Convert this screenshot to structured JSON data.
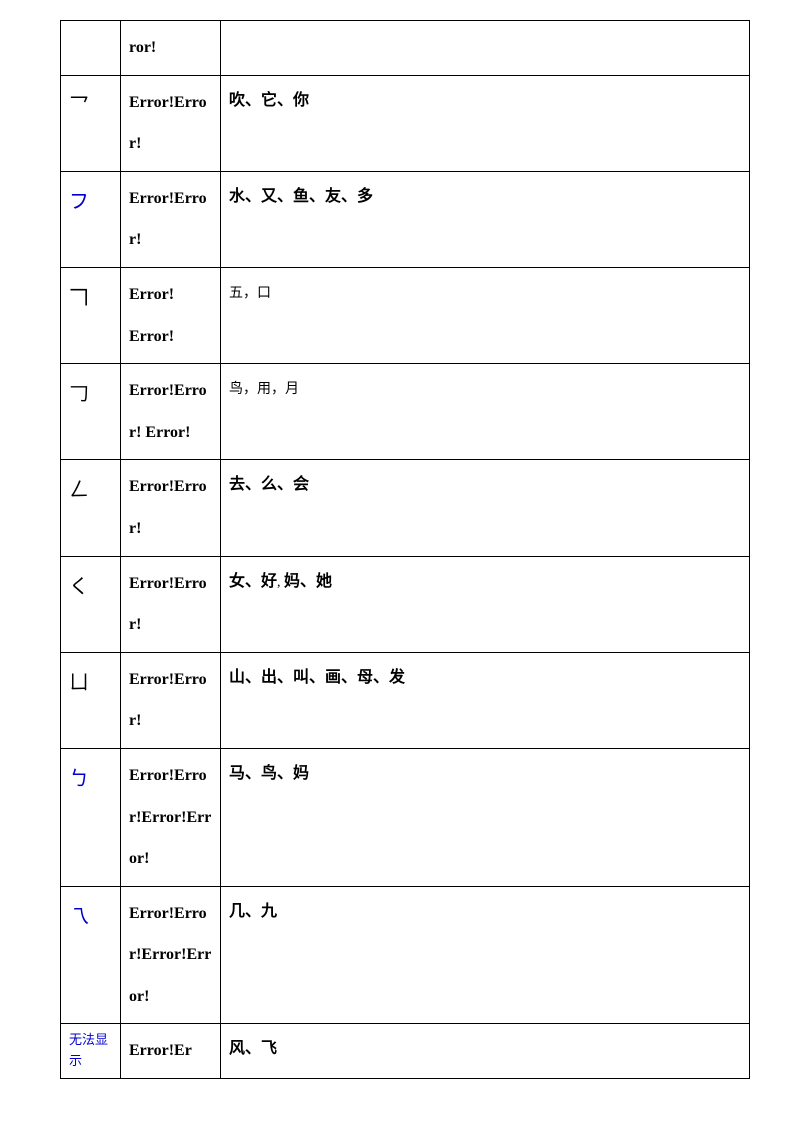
{
  "rows": [
    {
      "stroke": "",
      "stroke_blue": false,
      "err": "ror!",
      "chars": "",
      "chars_light": false
    },
    {
      "stroke": "乛",
      "stroke_blue": false,
      "err": "Error!Error!",
      "chars": "吹、它、你",
      "chars_light": false
    },
    {
      "stroke": "フ",
      "stroke_blue": true,
      "err": "Error!Error!",
      "chars": "水、又、鱼、友、多",
      "chars_light": false
    },
    {
      "stroke": "𠃍",
      "stroke_blue": false,
      "err": "Error! Error!",
      "chars": "五，口",
      "chars_light": true
    },
    {
      "stroke": "𠃌",
      "stroke_blue": false,
      "err": "Error!Error! Error!",
      "chars": "鸟，用，月",
      "chars_light": true
    },
    {
      "stroke": "ㄥ",
      "stroke_blue": false,
      "err": "Error!Error!",
      "chars": "去、么、会",
      "chars_light": false
    },
    {
      "stroke": "く",
      "stroke_blue": false,
      "err": "Error!Error!",
      "chars_mixed": [
        "女、好",
        ", ",
        "妈、她"
      ],
      "chars_light": false
    },
    {
      "stroke": "ㄩ",
      "stroke_blue": false,
      "err": "Error!Error!",
      "chars": "山、出、叫、画、母、发",
      "chars_light": false
    },
    {
      "stroke": "ㄅ",
      "stroke_blue": true,
      "err": "Error!Error!Error!Error!",
      "chars": "马、鸟、妈",
      "chars_light": false
    },
    {
      "stroke": "乁",
      "stroke_blue": true,
      "err": "Error!Error!Error!Error!",
      "chars": "几、九",
      "chars_light": false
    },
    {
      "stroke_special": "无法显示",
      "stroke_blue": true,
      "err": "Error!Er",
      "chars": "风、飞",
      "chars_light": false
    }
  ]
}
